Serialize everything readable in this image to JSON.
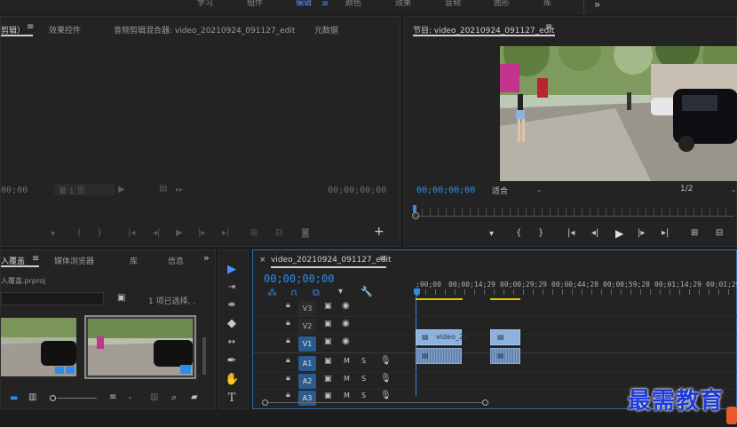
{
  "workspace_tabs": [
    "学习",
    "组件",
    "编辑",
    "颜色",
    "效果",
    "音频",
    "图形",
    "库"
  ],
  "workspace_active": "编辑",
  "workspace_more": "»",
  "source_panel": {
    "tabs": [
      "剪辑）",
      "效果控件",
      "音频剪辑混合器: video_20210924_091127_edit",
      "元数据"
    ],
    "timecode_left": "00;00",
    "page_label": "第 1 页",
    "timecode_right": "00;00;00;00"
  },
  "program_panel": {
    "title": "节目: video_20210924_091127_edit",
    "timecode": "00;00;00;00",
    "fit": "适合",
    "resolution": "1/2"
  },
  "project_panel": {
    "tabs": [
      "入覆盖",
      "媒体浏览器",
      "库",
      "信息"
    ],
    "project_file": "入覆盖.prproj",
    "selection": "1 项已选择, ."
  },
  "timeline": {
    "sequence_name": "video_20210924_091127_edit",
    "timecode": "00;00;00;00",
    "ruler": [
      ";00;00",
      "00;00;14;29",
      "00;00;29;29",
      "00;00;44;28",
      "00;00;59;28",
      "00;01;14;29",
      "00;01;29;29"
    ],
    "video_tracks": [
      "V3",
      "V2",
      "V1"
    ],
    "audio_tracks": [
      "A1",
      "A2",
      "A3"
    ],
    "clip_label": "video_20",
    "mute": "M",
    "solo": "S"
  },
  "watermark": "最需教育",
  "colors": {
    "accent": "#2d8ceb",
    "clip_video": "#8fb1dd",
    "clip_audio": "#6f8fb8",
    "work_area": "#e6c200"
  }
}
